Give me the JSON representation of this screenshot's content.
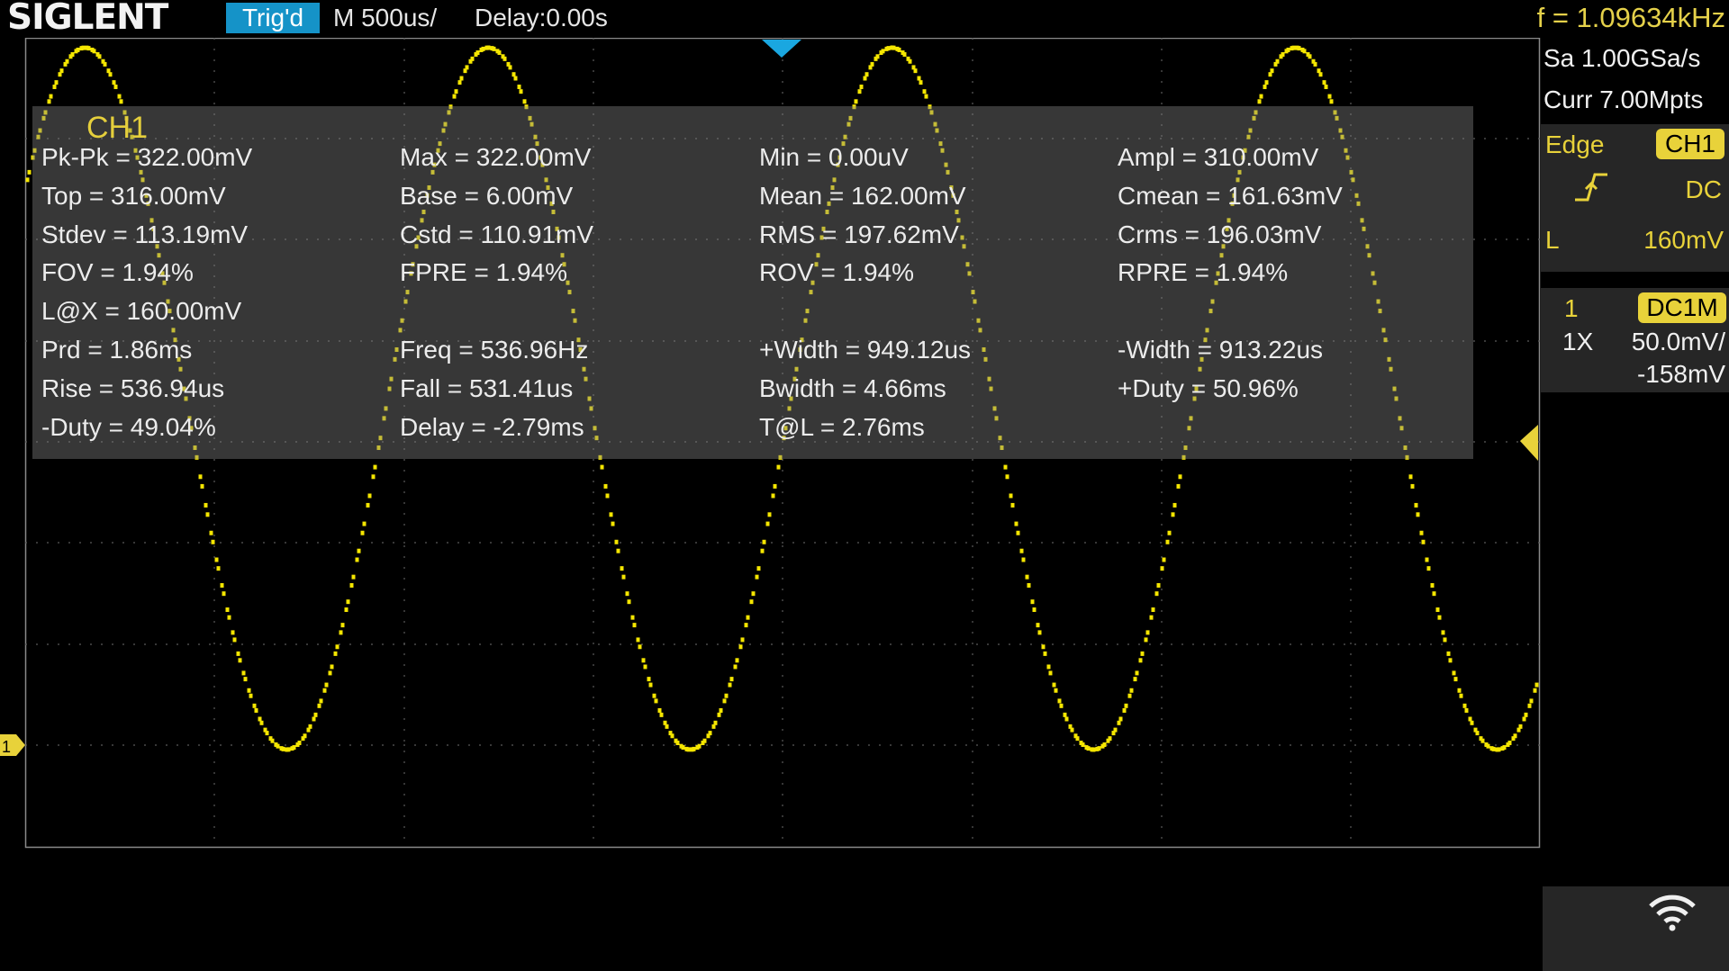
{
  "header": {
    "logo": "SIGLENT",
    "trigger_status": "Trig'd",
    "timebase": "M 500us/",
    "delay": "Delay:0.00s",
    "frequency": "f = 1.09634kHz"
  },
  "acquisition": {
    "sample_rate": "Sa 1.00GSa/s",
    "memory_depth": "Curr 7.00Mpts"
  },
  "trigger": {
    "type": "Edge",
    "source": "CH1",
    "slope_icon": "rising-edge-icon",
    "coupling": "DC",
    "level_label": "L",
    "level": "160mV"
  },
  "channel1": {
    "number": "1",
    "coupling": "DC1M",
    "probe": "1X",
    "scale": "50.0mV/",
    "offset": "-158mV",
    "ground_marker": "1"
  },
  "measurements": {
    "title": "CH1",
    "rows": [
      [
        "Pk-Pk = 322.00mV",
        "Max = 322.00mV",
        "Min = 0.00uV",
        "Ampl = 310.00mV"
      ],
      [
        "Top = 316.00mV",
        "Base = 6.00mV",
        "Mean = 162.00mV",
        "Cmean = 161.63mV"
      ],
      [
        "Stdev = 113.19mV",
        "Cstd = 110.91mV",
        "RMS = 197.62mV",
        "Crms = 196.03mV"
      ],
      [
        "FOV = 1.94%",
        "FPRE = 1.94%",
        "ROV = 1.94%",
        "RPRE = 1.94%"
      ],
      [
        "L@X = 160.00mV",
        "",
        "",
        ""
      ],
      [
        "Prd = 1.86ms",
        "Freq = 536.96Hz",
        "+Width = 949.12us",
        "-Width = 913.22us"
      ],
      [
        "Rise = 536.94us",
        "Fall = 531.41us",
        "Bwidth = 4.66ms",
        "+Duty = 50.96%"
      ],
      [
        "-Duty = 49.04%",
        "Delay = -2.79ms",
        "T@L = 2.76ms",
        ""
      ]
    ]
  },
  "icons": {
    "wifi": "wifi-icon",
    "trigger_position": "trigger-position-marker-icon",
    "trigger_level": "trigger-level-marker-icon"
  },
  "colors": {
    "trace": "#f5e600",
    "channel": "#e8d23a",
    "trig_badge": "#1593c8",
    "panel": "#262626",
    "grid": "#5a5a5a"
  }
}
